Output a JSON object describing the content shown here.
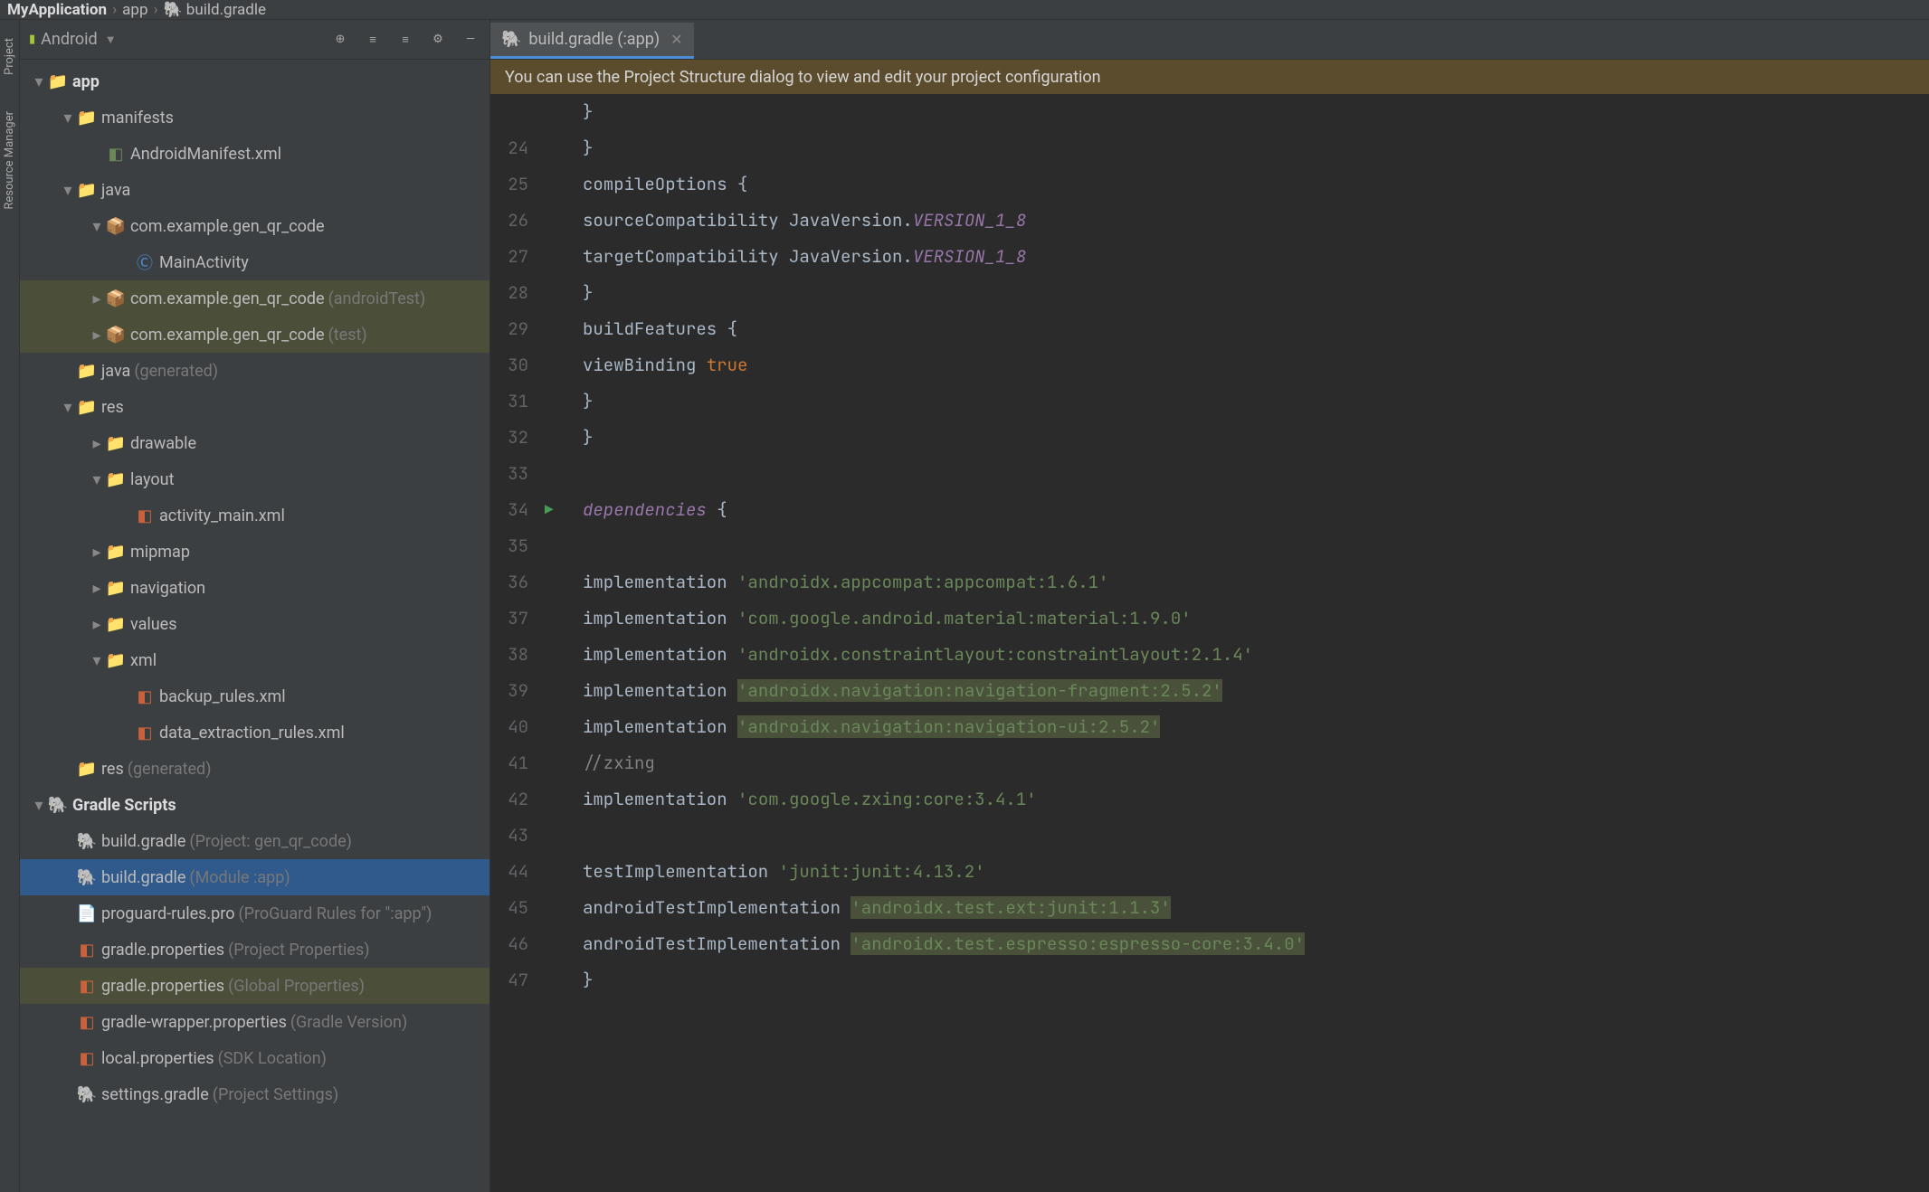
{
  "breadcrumb": {
    "root": "MyApplication",
    "part1": "app",
    "part2": "build.gradle"
  },
  "panel": {
    "title": "Android"
  },
  "sidebar_rail": {
    "project": "Project",
    "resource_manager": "Resource Manager"
  },
  "tree": [
    {
      "indent": 0,
      "arrow": "▾",
      "iconType": "folder-blue",
      "name": "app",
      "bold": true
    },
    {
      "indent": 1,
      "arrow": "▾",
      "iconType": "folder-blue",
      "name": "manifests"
    },
    {
      "indent": 2,
      "arrow": "",
      "iconType": "xml-mf",
      "name": "AndroidManifest.xml"
    },
    {
      "indent": 1,
      "arrow": "▾",
      "iconType": "folder-blue",
      "name": "java"
    },
    {
      "indent": 2,
      "arrow": "▾",
      "iconType": "package",
      "name": "com.example.gen_qr_code"
    },
    {
      "indent": 3,
      "arrow": "",
      "iconType": "class",
      "name": "MainActivity"
    },
    {
      "indent": 2,
      "arrow": "▸",
      "iconType": "package",
      "name": "com.example.gen_qr_code",
      "suffix": "(androidTest)",
      "hl": true
    },
    {
      "indent": 2,
      "arrow": "▸",
      "iconType": "package",
      "name": "com.example.gen_qr_code",
      "suffix": "(test)",
      "hl": true
    },
    {
      "indent": 1,
      "arrow": "",
      "iconType": "folder-gen",
      "name": "java",
      "suffix": "(generated)"
    },
    {
      "indent": 1,
      "arrow": "▾",
      "iconType": "folder-res",
      "name": "res"
    },
    {
      "indent": 2,
      "arrow": "▸",
      "iconType": "folder",
      "name": "drawable"
    },
    {
      "indent": 2,
      "arrow": "▾",
      "iconType": "folder",
      "name": "layout"
    },
    {
      "indent": 3,
      "arrow": "",
      "iconType": "xml",
      "name": "activity_main.xml"
    },
    {
      "indent": 2,
      "arrow": "▸",
      "iconType": "folder",
      "name": "mipmap"
    },
    {
      "indent": 2,
      "arrow": "▸",
      "iconType": "folder",
      "name": "navigation"
    },
    {
      "indent": 2,
      "arrow": "▸",
      "iconType": "folder",
      "name": "values"
    },
    {
      "indent": 2,
      "arrow": "▾",
      "iconType": "folder",
      "name": "xml"
    },
    {
      "indent": 3,
      "arrow": "",
      "iconType": "xml",
      "name": "backup_rules.xml"
    },
    {
      "indent": 3,
      "arrow": "",
      "iconType": "xml",
      "name": "data_extraction_rules.xml"
    },
    {
      "indent": 1,
      "arrow": "",
      "iconType": "folder-gen",
      "name": "res",
      "suffix": "(generated)"
    },
    {
      "indent": 0,
      "arrow": "▾",
      "iconType": "gradle",
      "name": "Gradle Scripts",
      "bold": true
    },
    {
      "indent": 1,
      "arrow": "",
      "iconType": "gradle",
      "name": "build.gradle",
      "suffix": "(Project: gen_qr_code)"
    },
    {
      "indent": 1,
      "arrow": "",
      "iconType": "gradle",
      "name": "build.gradle",
      "suffix": "(Module :app)",
      "selected": true
    },
    {
      "indent": 1,
      "arrow": "",
      "iconType": "file",
      "name": "proguard-rules.pro",
      "suffix": "(ProGuard Rules for \":app\")"
    },
    {
      "indent": 1,
      "arrow": "",
      "iconType": "prop",
      "name": "gradle.properties",
      "suffix": "(Project Properties)"
    },
    {
      "indent": 1,
      "arrow": "",
      "iconType": "prop",
      "name": "gradle.properties",
      "suffix": "(Global Properties)",
      "hl": true
    },
    {
      "indent": 1,
      "arrow": "",
      "iconType": "prop",
      "name": "gradle-wrapper.properties",
      "suffix": "(Gradle Version)"
    },
    {
      "indent": 1,
      "arrow": "",
      "iconType": "prop",
      "name": "local.properties",
      "suffix": "(SDK Location)"
    },
    {
      "indent": 1,
      "arrow": "",
      "iconType": "gradle",
      "name": "settings.gradle",
      "suffix": "(Project Settings)"
    }
  ],
  "tab": {
    "label": "build.gradle (:app)"
  },
  "banner": {
    "text": "You can use the Project Structure dialog to view and edit your project configuration"
  },
  "code": {
    "lines": [
      {
        "n": "",
        "text": "        }"
      },
      {
        "n": "24",
        "text": "    }"
      },
      {
        "n": "25",
        "text": "    compileOptions {"
      },
      {
        "n": "26",
        "text": "        sourceCompatibility JavaVersion.",
        "prop": "VERSION_1_8"
      },
      {
        "n": "27",
        "text": "        targetCompatibility JavaVersion.",
        "prop": "VERSION_1_8"
      },
      {
        "n": "28",
        "text": "    }"
      },
      {
        "n": "29",
        "text": "    buildFeatures {"
      },
      {
        "n": "30",
        "text": "        viewBinding ",
        "kw": "true"
      },
      {
        "n": "31",
        "text": "    }"
      },
      {
        "n": "32",
        "text": "}"
      },
      {
        "n": "33",
        "text": ""
      },
      {
        "n": "34",
        "text": "",
        "block": "dependencies",
        "after": " {",
        "run": true
      },
      {
        "n": "35",
        "text": ""
      },
      {
        "n": "36",
        "text": "    implementation ",
        "str": "'androidx.appcompat:appcompat:1.6.1'"
      },
      {
        "n": "37",
        "text": "    implementation ",
        "str": "'com.google.android.material:material:1.9.0'"
      },
      {
        "n": "38",
        "text": "    implementation ",
        "str": "'androidx.constraintlayout:constraintlayout:2.1.4'"
      },
      {
        "n": "39",
        "text": "    implementation ",
        "strHi": "'androidx.navigation:navigation-fragment:2.5.2'"
      },
      {
        "n": "40",
        "text": "    implementation ",
        "strHi": "'androidx.navigation:navigation-ui:2.5.2'"
      },
      {
        "n": "41",
        "text": "    ",
        "comment": "//zxing"
      },
      {
        "n": "42",
        "text": "    implementation ",
        "str": "'com.google.zxing:core:3.4.1'"
      },
      {
        "n": "43",
        "text": ""
      },
      {
        "n": "44",
        "text": "    testImplementation ",
        "str": "'junit:junit:4.13.2'"
      },
      {
        "n": "45",
        "text": "    androidTestImplementation ",
        "strHi": "'androidx.test.ext:junit:1.1.3'"
      },
      {
        "n": "46",
        "text": "    androidTestImplementation ",
        "strHi": "'androidx.test.espresso:espresso-core:3.4.0'"
      },
      {
        "n": "47",
        "text": "}"
      }
    ]
  }
}
